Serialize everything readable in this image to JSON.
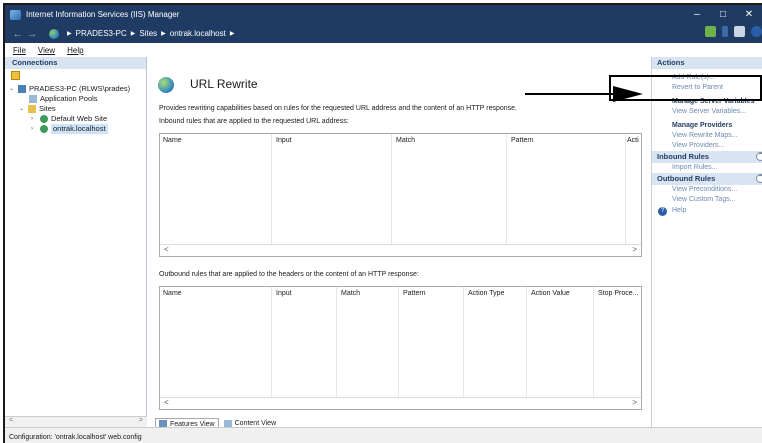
{
  "window": {
    "title": "Internet Information Services (IIS) Manager",
    "controls": {
      "minimize": "–",
      "maximize": "□",
      "close": "✕"
    }
  },
  "addressbar": {
    "back": "←",
    "forward": "→",
    "crumbs": [
      "PRADES3-PC",
      "Sites",
      "ontrak.localhost"
    ],
    "separator": "▶"
  },
  "menu": {
    "file": "File",
    "view": "View",
    "help": "Help"
  },
  "connections": {
    "header": "Connections",
    "tree": {
      "server": "PRADES3-PC (RLWS\\prades)",
      "app_pools": "Application Pools",
      "sites": "Sites",
      "default_site": "Default Web Site",
      "ontrak": "ontrak.localhost"
    },
    "scroll_left": "<",
    "scroll_right": ">"
  },
  "main": {
    "title": "URL Rewrite",
    "description": "Provides rewriting capabilities based on rules for the requested URL address and the content of an HTTP response.",
    "inbound_label": "Inbound rules that are applied to the requested URL address:",
    "inbound_columns": [
      "Name",
      "Input",
      "Match",
      "Pattern",
      "Acti"
    ],
    "outbound_label": "Outbound rules that are applied to the headers or the content of an HTTP response:",
    "outbound_columns": [
      "Name",
      "Input",
      "Match",
      "Pattern",
      "Action Type",
      "Action Value",
      "Stop Proce..."
    ],
    "scroll_left": "<",
    "scroll_right": ">",
    "tabs": {
      "features": "Features View",
      "content": "Content View"
    }
  },
  "actions": {
    "header": "Actions",
    "add_rules": "Add Rule(s)...",
    "revert": "Revert to Parent",
    "manage_server_vars_title": "Manage Server Variables",
    "view_server_vars": "View Server Variables...",
    "manage_providers_title": "Manage Providers",
    "view_rewrite_maps": "View Rewrite Maps...",
    "view_providers": "View Providers...",
    "inbound_header": "Inbound Rules",
    "import_rules": "Import Rules...",
    "outbound_header": "Outbound Rules",
    "view_preconditions": "View Preconditions...",
    "view_custom_tags": "View Custom Tags...",
    "help": "Help"
  },
  "status": {
    "text": "Configuration: 'ontrak.localhost' web.config"
  },
  "colors": {
    "titlebar": "#1f3b63",
    "panel_header": "#d9e4f2",
    "link": "#6d89b0"
  }
}
